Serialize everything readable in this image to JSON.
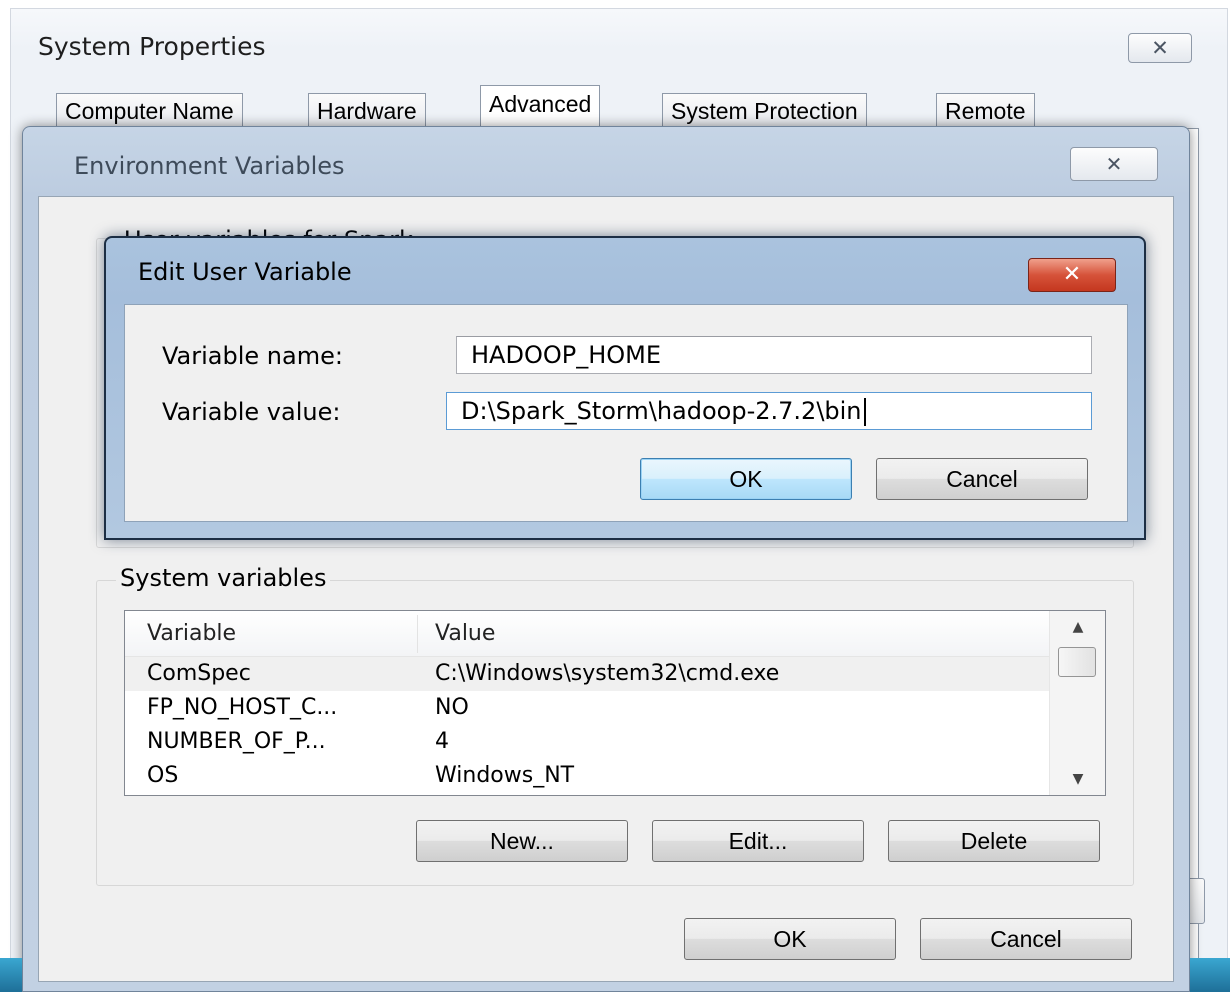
{
  "system_properties": {
    "title": "System Properties",
    "close_glyph": "✕",
    "tabs": [
      {
        "label": "Computer Name"
      },
      {
        "label": "Hardware"
      },
      {
        "label": "Advanced",
        "active": true
      },
      {
        "label": "System Protection"
      },
      {
        "label": "Remote"
      }
    ]
  },
  "environment_variables": {
    "title": "Environment Variables",
    "close_glyph": "✕",
    "user_group_label": "User variables for Spark",
    "system_group_label": "System variables",
    "system_table": {
      "columns": [
        "Variable",
        "Value"
      ],
      "rows": [
        {
          "variable": "ComSpec",
          "value": "C:\\Windows\\system32\\cmd.exe",
          "selected": true
        },
        {
          "variable": "FP_NO_HOST_C...",
          "value": "NO"
        },
        {
          "variable": "NUMBER_OF_P...",
          "value": "4"
        },
        {
          "variable": "OS",
          "value": "Windows_NT"
        }
      ]
    },
    "buttons": {
      "new": "New...",
      "edit": "Edit...",
      "delete": "Delete",
      "ok": "OK",
      "cancel": "Cancel"
    }
  },
  "edit_user_variable": {
    "title": "Edit User Variable",
    "close_glyph": "✕",
    "name_label": "Variable name:",
    "name_value": "HADOOP_HOME",
    "value_label": "Variable value:",
    "value_value": "D:\\Spark_Storm\\hadoop-2.7.2\\bin",
    "ok_label": "OK",
    "cancel_label": "Cancel"
  },
  "colors": {
    "aero_frame": "#bccce0",
    "active_frame": "#a5bedb",
    "close_red": "#c4371f",
    "default_button": "#bee6fd"
  }
}
